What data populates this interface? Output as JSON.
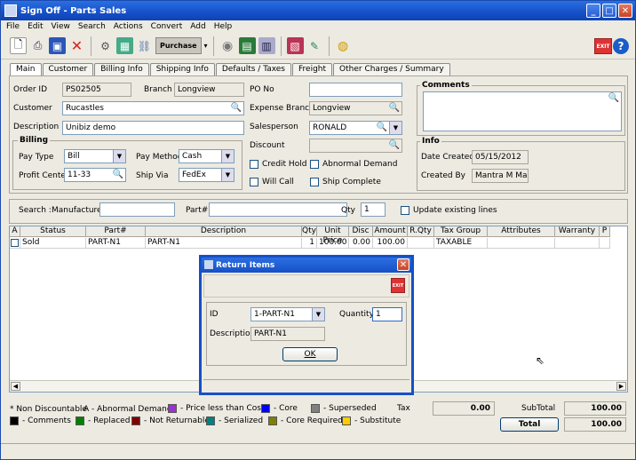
{
  "window": {
    "title": "Sign Off - Parts Sales"
  },
  "menu": [
    "File",
    "Edit",
    "View",
    "Search",
    "Actions",
    "Convert",
    "Add",
    "Help"
  ],
  "toolbar": {
    "purchase_label": "Purchase",
    "exit_label": "EXIT"
  },
  "tabs": [
    "Main",
    "Customer",
    "Billing Info",
    "Shipping Info",
    "Defaults / Taxes",
    "Freight",
    "Other Charges / Summary"
  ],
  "form": {
    "order_id_label": "Order ID",
    "order_id": "PS02505",
    "branch_label": "Branch",
    "branch": "Longview",
    "customer_label": "Customer",
    "customer": "Rucastles",
    "description_label": "Description",
    "description": "Unibiz demo",
    "po_no_label": "PO No",
    "po_no": "",
    "expense_branch_label": "Expense Branch",
    "expense_branch": "Longview",
    "salesperson_label": "Salesperson",
    "salesperson": "RONALD",
    "discount_label": "Discount",
    "discount": "",
    "credit_hold_label": "Credit Hold",
    "abnormal_demand_label": "Abnormal Demand",
    "will_call_label": "Will Call",
    "ship_complete_label": "Ship Complete",
    "billing_title": "Billing",
    "pay_type_label": "Pay Type",
    "pay_type": "Bill",
    "pay_method_label": "Pay Method",
    "pay_method": "Cash",
    "profit_center_label": "Profit Center",
    "profit_center": "11-33",
    "ship_via_label": "Ship Via",
    "ship_via": "FedEx",
    "comments_title": "Comments",
    "info_title": "Info",
    "date_created_label": "Date Created",
    "date_created": "05/15/2012",
    "created_by_label": "Created By",
    "created_by": "Mantra M Mantra"
  },
  "search": {
    "title": "Search :",
    "manufacturer_label": "Manufacturer",
    "part_label": "Part#",
    "qty_label": "Qty",
    "qty": "1",
    "update_label": "Update existing lines"
  },
  "grid": {
    "headers": [
      "A",
      "Status",
      "Part#",
      "Description",
      "Qty",
      "Unit Price",
      "Disc",
      "Amount",
      "R.Qty",
      "Tax Group",
      "Attributes",
      "Warranty",
      "P"
    ],
    "rows": [
      [
        "",
        "Sold",
        "PART-N1",
        "PART-N1",
        "1",
        "100.00",
        "0.00",
        "100.00",
        "",
        "TAXABLE",
        "",
        "",
        ""
      ]
    ]
  },
  "legend": {
    "non_discountable": "* Non Discountable",
    "abnormal": "A - Abnormal Demand",
    "items": [
      {
        "label": "- Price less than Cost",
        "color": "#9933cc"
      },
      {
        "label": "- Core",
        "color": "#0000ff"
      },
      {
        "label": "- Superseded",
        "color": "#808080"
      },
      {
        "label": "- Comments",
        "color": "#000000"
      },
      {
        "label": "- Replaced",
        "color": "#008000"
      },
      {
        "label": "- Not Returnable",
        "color": "#800000"
      },
      {
        "label": "- Serialized",
        "color": "#008080"
      },
      {
        "label": "- Core Required",
        "color": "#808000"
      },
      {
        "label": "- Substitute",
        "color": "#ffcc00"
      }
    ]
  },
  "totals": {
    "tax_label": "Tax",
    "tax": "0.00",
    "subtotal_label": "SubTotal",
    "subtotal": "100.00",
    "total_label": "Total",
    "total": "100.00"
  },
  "dialog": {
    "title": "Return Items",
    "exit_label": "EXIT",
    "id_label": "ID",
    "id_value": "1-PART-N1",
    "quantity_label": "Quantity",
    "quantity": "1",
    "description_label": "Description",
    "description": "PART-N1",
    "ok_label": "OK"
  }
}
